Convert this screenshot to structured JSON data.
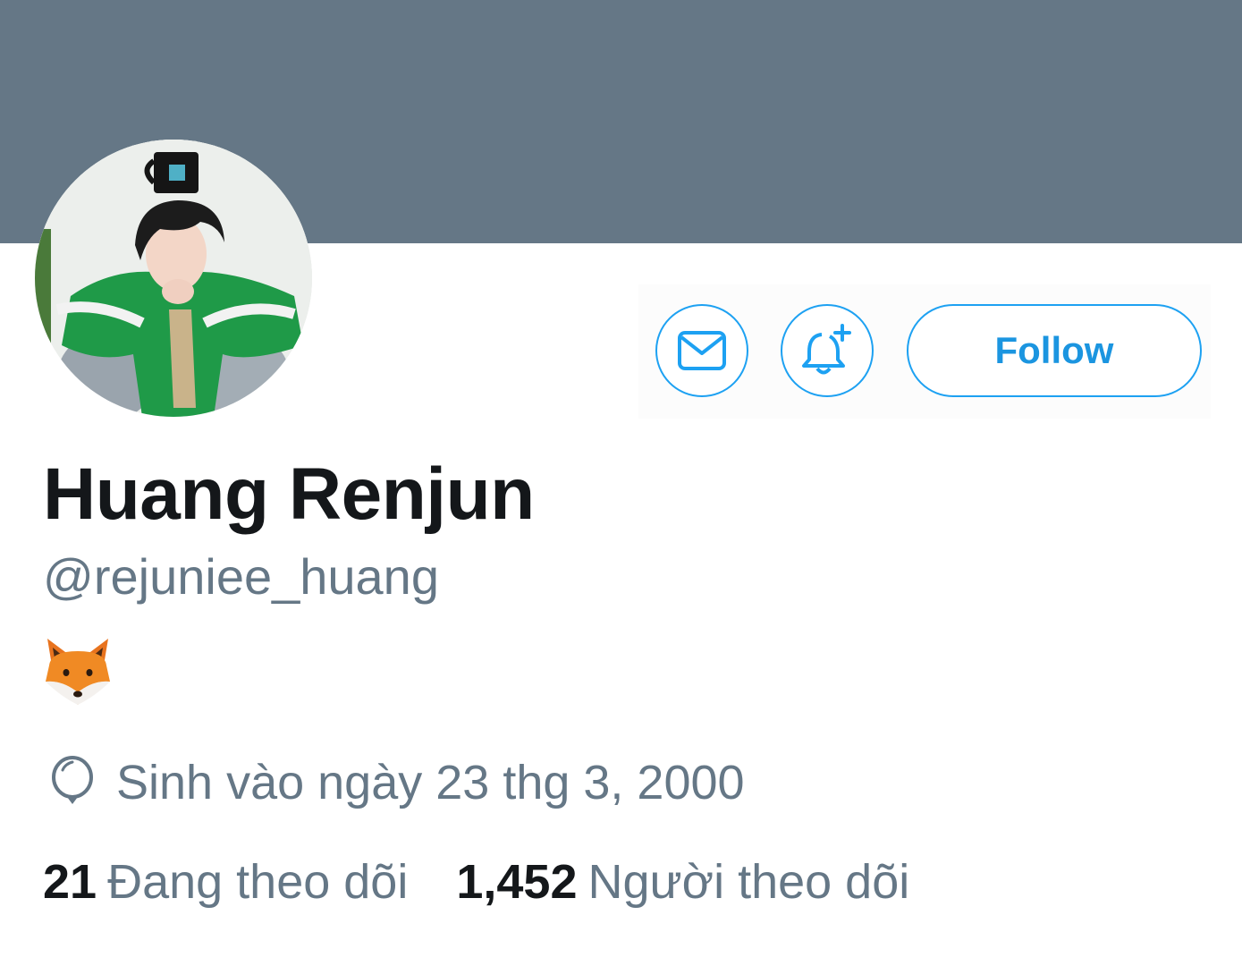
{
  "colors": {
    "banner": "#657786",
    "accent": "#1da1f2",
    "accent_text": "#1b95e0",
    "primary_text": "#14171a",
    "secondary_text": "#657786"
  },
  "profile": {
    "display_name": "Huang Renjun",
    "handle": "@rejuniee_huang",
    "bio_icon": "fox-face-emoji",
    "avatar_alt": "profile-photo"
  },
  "actions": {
    "message_icon": "envelope-icon",
    "notify_icon": "bell-plus-icon",
    "follow_label": "Follow"
  },
  "birth": {
    "icon": "balloon-icon",
    "text": "Sinh vào ngày 23 thg 3, 2000"
  },
  "stats": {
    "following_count": "21",
    "following_label": "Đang theo dõi",
    "followers_count": "1,452",
    "followers_label": "Người theo dõi"
  }
}
